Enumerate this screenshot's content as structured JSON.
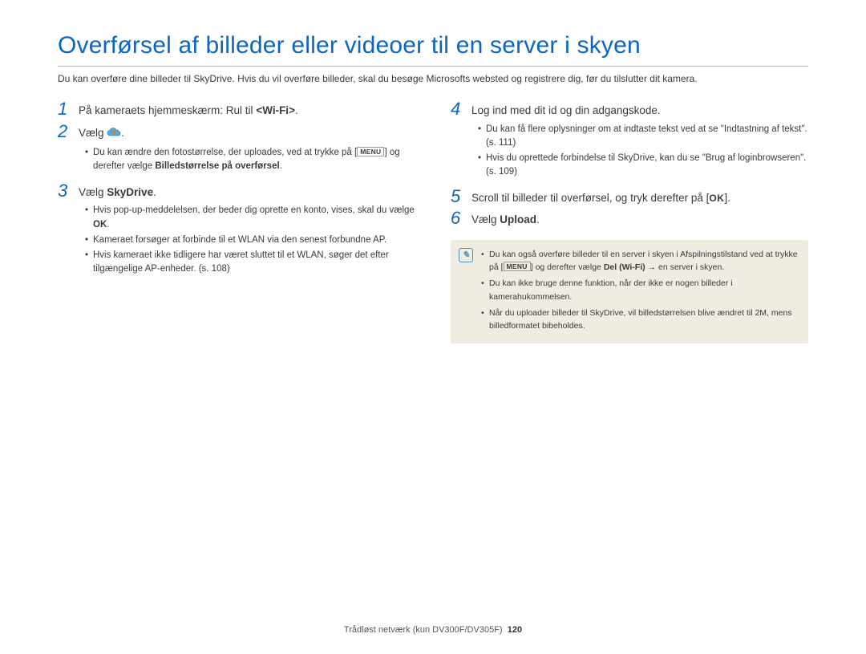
{
  "title": "Overførsel af billeder eller videoer til en server i skyen",
  "intro": "Du kan overføre dine billeder til SkyDrive. Hvis du vil overføre billeder, skal du besøge Microsofts websted og registrere dig, før du tilslutter dit kamera.",
  "left": {
    "step1_pre": "På kameraets hjemmeskærm: Rul til ",
    "step1_wifi": "<Wi-Fi>",
    "step1_post": ".",
    "step2": "Vælg ",
    "step2_icon": "cloud-icon",
    "step2_bullet_a": "Du kan ændre den fotostørrelse, der uploades, ved at trykke på [",
    "step2_menu": "MENU",
    "step2_bullet_b": "] og derefter vælge ",
    "step2_bullet_bold": "Billedstørrelse på overførsel",
    "step2_bullet_c": ".",
    "step3_pre": "Vælg ",
    "step3_bold": "SkyDrive",
    "step3_post": ".",
    "step3_b1a": "Hvis pop-up-meddelelsen, der beder dig oprette en konto, vises, skal du vælge ",
    "step3_b1b": "OK",
    "step3_b1c": ".",
    "step3_b2": "Kameraet forsøger at forbinde til et WLAN via den senest forbundne AP.",
    "step3_b3": "Hvis kameraet ikke tidligere har været sluttet til et WLAN, søger det efter tilgængelige AP-enheder. (s. 108)"
  },
  "right": {
    "step4": "Log ind med dit id og din adgangskode.",
    "step4_b1": "Du kan få flere oplysninger om at indtaste tekst ved at se \"Indtastning af tekst\". (s. 111)",
    "step4_b2": "Hvis du oprettede forbindelse til SkyDrive, kan du se \"Brug af loginbrowseren\". (s. 109)",
    "step5_pre": "Scroll til billeder til overførsel, og tryk derefter på [",
    "step5_ok": "OK",
    "step5_post": "].",
    "step6_pre": "Vælg ",
    "step6_bold": "Upload",
    "step6_post": ".",
    "note1a": "Du kan også overføre billeder til en server i skyen i Afspilningstilstand ved at trykke på [",
    "note1_menu": "MENU",
    "note1b": "] og derefter vælge ",
    "note1_bold": "Del (Wi-Fi)",
    "note1_arrow": " → ",
    "note1c": "en server i skyen.",
    "note2": "Du kan ikke bruge denne funktion, når der ikke er nogen billeder i kamerahukommelsen.",
    "note3": "Når du uploader billeder til SkyDrive, vil billedstørrelsen blive ændret til 2M, mens billedformatet bibeholdes."
  },
  "footer": {
    "label": "Trådløst netværk (kun DV300F/DV305F)",
    "page": "120"
  }
}
